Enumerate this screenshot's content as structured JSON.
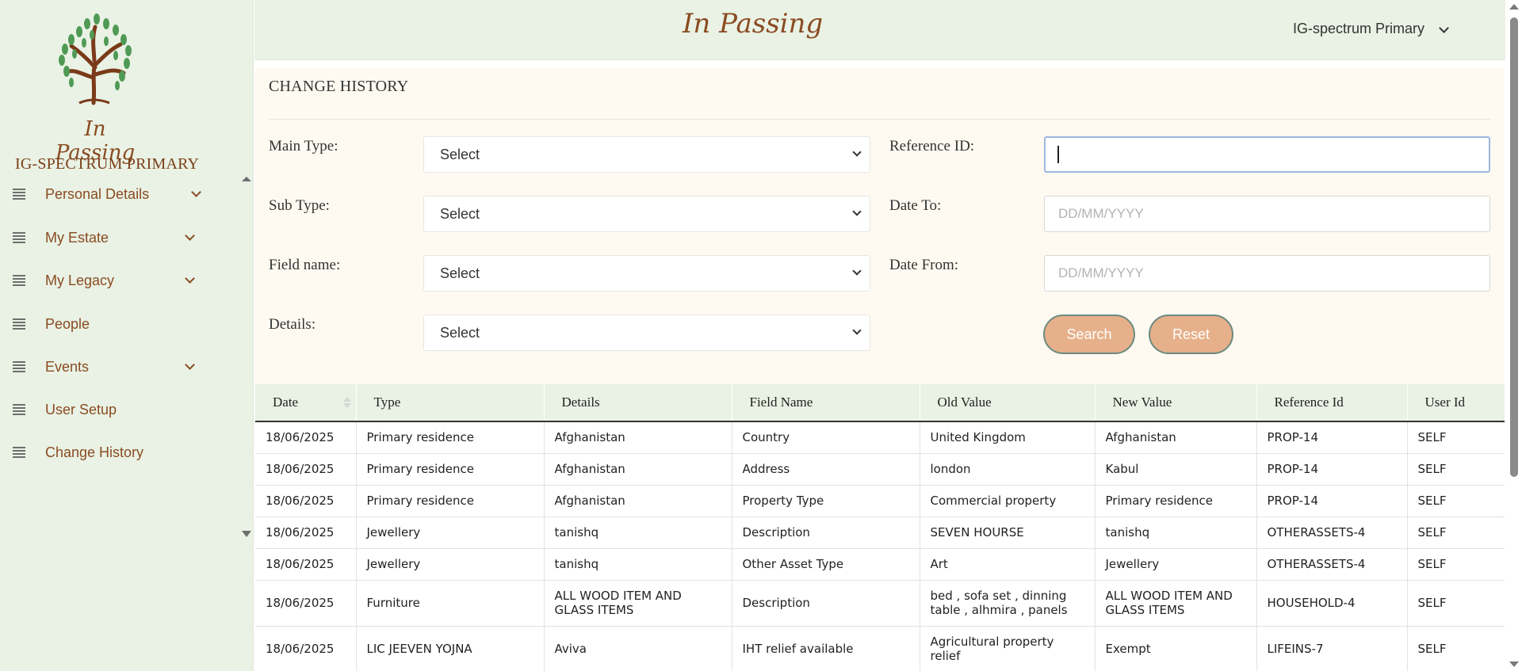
{
  "brand": {
    "logo_text": "In Passing",
    "header_title": "In Passing"
  },
  "account": {
    "name": "IG-SPECTRUM PRIMARY",
    "user_menu_label": "IG-spectrum Primary"
  },
  "sidebar": {
    "items": [
      {
        "label": "Personal Details",
        "icon": "hamburger-icon",
        "expandable": true
      },
      {
        "label": "My Estate",
        "icon": "hamburger-icon",
        "expandable": true
      },
      {
        "label": "My Legacy",
        "icon": "hamburger-icon",
        "expandable": true
      },
      {
        "label": "People",
        "icon": "hamburger-icon",
        "expandable": false
      },
      {
        "label": "Events",
        "icon": "hamburger-icon",
        "expandable": true
      },
      {
        "label": "User Setup",
        "icon": "hamburger-icon",
        "expandable": false
      },
      {
        "label": "Change History",
        "icon": "hamburger-icon",
        "expandable": false
      }
    ]
  },
  "panel": {
    "title": "CHANGE HISTORY",
    "main_type": {
      "label": "Main Type:",
      "value": "Select"
    },
    "sub_type": {
      "label": "Sub Type:",
      "value": "Select"
    },
    "field_name": {
      "label": "Field name:",
      "value": "Select"
    },
    "details": {
      "label": "Details:",
      "value": "Select"
    },
    "reference_id": {
      "label": "Reference ID:",
      "value": ""
    },
    "date_to": {
      "label": "Date To:",
      "placeholder": "DD/MM/YYYY"
    },
    "date_from": {
      "label": "Date From:",
      "placeholder": "DD/MM/YYYY"
    },
    "search_label": "Search",
    "reset_label": "Reset"
  },
  "table": {
    "headers": [
      "Date",
      "Type",
      "Details",
      "Field Name",
      "Old Value",
      "New Value",
      "Reference Id",
      "User Id"
    ],
    "rows": [
      [
        "18/06/2025",
        "Primary residence",
        "Afghanistan",
        "Country",
        "United Kingdom",
        "Afghanistan",
        "PROP-14",
        "SELF"
      ],
      [
        "18/06/2025",
        "Primary residence",
        "Afghanistan",
        "Address",
        "london",
        "Kabul",
        "PROP-14",
        "SELF"
      ],
      [
        "18/06/2025",
        "Primary residence",
        "Afghanistan",
        "Property Type",
        "Commercial property",
        "Primary residence",
        "PROP-14",
        "SELF"
      ],
      [
        "18/06/2025",
        "Jewellery",
        "tanishq",
        "Description",
        "SEVEN HOURSE",
        "tanishq",
        "OTHERASSETS-4",
        "SELF"
      ],
      [
        "18/06/2025",
        "Jewellery",
        "tanishq",
        "Other Asset Type",
        "Art",
        "Jewellery",
        "OTHERASSETS-4",
        "SELF"
      ],
      [
        "18/06/2025",
        "Furniture",
        "ALL WOOD ITEM AND GLASS ITEMS",
        "Description",
        "bed , sofa set , dinning table , alhmira , panels",
        "ALL WOOD ITEM AND GLASS ITEMS",
        "HOUSEHOLD-4",
        "SELF"
      ],
      [
        "18/06/2025",
        "LIC JEEVEN YOJNA",
        "Aviva",
        "IHT relief available",
        "Agricultural property relief",
        "Exempt",
        "LIFEINS-7",
        "SELF"
      ]
    ]
  },
  "colors": {
    "sidebar_bg": "#e9f2e4",
    "brand": "#8a4b22",
    "panel_bg": "#fffaf1",
    "button": "#e6b08a"
  }
}
